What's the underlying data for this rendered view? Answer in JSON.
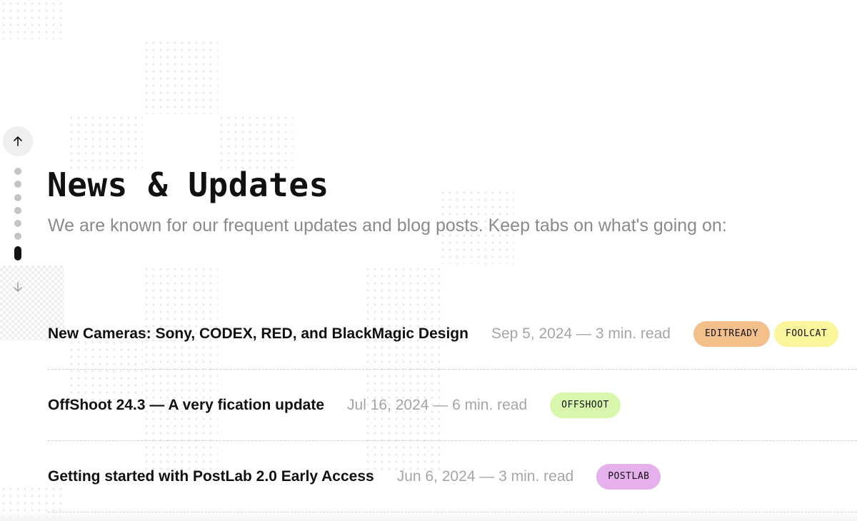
{
  "header": {
    "title": "News & Updates",
    "subtitle": "We are known for our frequent updates and blog posts. Keep tabs on what's going on:"
  },
  "scroll_nav": {
    "up_icon": "arrow-up-icon",
    "down_icon": "arrow-down-icon",
    "dot_count": 7,
    "active_index": 6
  },
  "posts": [
    {
      "title": "New Cameras: Sony, CODEX, RED, and BlackMagic Design",
      "meta": "Sep 5, 2024 — 3 min. read",
      "tags": [
        {
          "label": "EDITREADY",
          "color": "#f3c08b"
        },
        {
          "label": "FOOLCAT",
          "color": "#fbf59b"
        }
      ]
    },
    {
      "title": "OffShoot 24.3 — A very fication update",
      "meta": "Jul 16, 2024 — 6 min. read",
      "tags": [
        {
          "label": "OFFSHOOT",
          "color": "#d8f7ad"
        }
      ]
    },
    {
      "title": "Getting started with PostLab 2.0 Early Access",
      "meta": "Jun 6, 2024 — 3 min. read",
      "tags": [
        {
          "label": "POSTLAB",
          "color": "#e6b0ec"
        }
      ]
    }
  ]
}
